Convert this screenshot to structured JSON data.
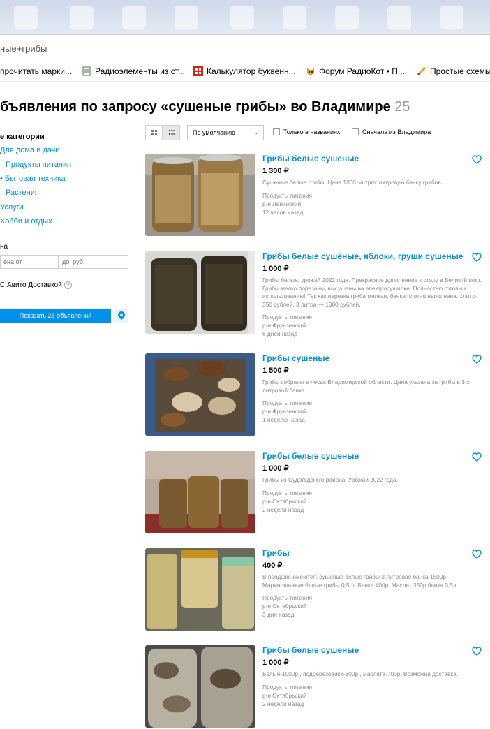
{
  "browser": {
    "url_fragment": "ные+грибы",
    "bookmarks": [
      {
        "label": "прочитать марки...",
        "icon": "none"
      },
      {
        "label": "Радиоэлементы из ст...",
        "icon": "page-icon"
      },
      {
        "label": "Калькулятор буквенн...",
        "icon": "red-grid-icon"
      },
      {
        "label": "Форум РадиоКот • П...",
        "icon": "cat-icon"
      },
      {
        "label": "Простые схемы",
        "icon": "pencil-icon"
      }
    ]
  },
  "page": {
    "heading": "бъявления по запросу «сушеные грибы» во Владимире",
    "count": "25"
  },
  "sidebar": {
    "category_title": "е категории",
    "categories": [
      {
        "label": "Для дома и дачи"
      },
      {
        "label": "Продукты питания"
      },
      {
        "label": "Бытовая техника"
      },
      {
        "label": "Растения"
      },
      {
        "label": "Услуги"
      },
      {
        "label": "Хобби и отдых"
      }
    ],
    "price_label": "на",
    "price_from_placeholder": "ена от",
    "price_to_placeholder": "до, руб.",
    "delivery_label": "С Авито Доставкой",
    "show_button": "Показать 25 объявлений"
  },
  "controls": {
    "sort_value": "По умолчанию",
    "only_titles": "Только в названиях",
    "from_city_first": "Сначала из Владимира"
  },
  "listings": [
    {
      "title": "Грибы белые сушеные",
      "price": "1 300 ₽",
      "description": "Сушеные белые грибы. Цена 1300 за трёх литровую банку грибов.",
      "category": "Продукты питания",
      "district": "р-н Ленинский",
      "time": "12 часов назад"
    },
    {
      "title": "Грибы белые сушёные, яблоки, груши сушеные",
      "price": "1 000 ₽",
      "description": "Грибы белые, урожай 2022 года. Прекрасное дополнение к столу в Великий пост. Грибы мелко порезаны, высушены на электросушилке. Полностью готовы к использованию! Так как нарезка гриба мелкая, банка плотно наполнена. 1литр- 350 рублей, 3 литра — 1000 рублей.",
      "category": "Продукты питания",
      "district": "р-н Фрунзенский",
      "time": "6 дней назад"
    },
    {
      "title": "Грибы сушеные",
      "price": "1 500 ₽",
      "description": "Грибы собраны в лесах Владимирской области. Цена указана за грибы в 3-х литровой банке.",
      "category": "Продукты питания",
      "district": "р-н Фрунзенский",
      "time": "1 неделю назад"
    },
    {
      "title": "Грибы белые сушеные",
      "price": "1 000 ₽",
      "description": "Грибы из Судогодского района. Урожай 2022 года.",
      "category": "Продукты питания",
      "district": "р-н Октябрьский",
      "time": "2 недели назад"
    },
    {
      "title": "Грибы",
      "price": "400 ₽",
      "description": "В продаже имеются: сушёные белые грибы 3 литровая банка 1500р. Маринованные белые грибы 0,5 л. Банка 400р. Маслят 350р банка 0,5л.",
      "category": "Продукты питания",
      "district": "р-н Октябрьский",
      "time": "3 дня назад"
    },
    {
      "title": "Грибы белые сушеные",
      "price": "1 000 ₽",
      "description": "Белые-1000р., подберёзовики-800р., маслята-700р. Возможна доставка.",
      "category": "Продукты питания",
      "district": "р-н Октябрьский",
      "time": "2 недели назад"
    }
  ],
  "colors": {
    "link": "#0091d9",
    "button": "#0091ea",
    "muted": "#8a8a8a"
  }
}
